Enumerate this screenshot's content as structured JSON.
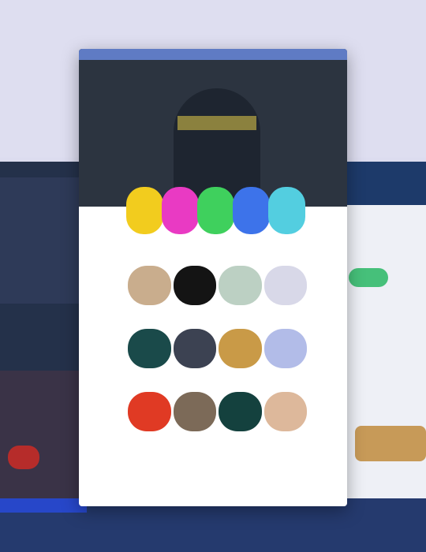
{
  "colors": {
    "background": "#dcdcef",
    "window_bg": "#ffffff",
    "accent_blue": "#2747c9"
  },
  "picker": {
    "section_label": "",
    "swatches": [
      {
        "name": "yellow",
        "color": "#f2cc1e"
      },
      {
        "name": "magenta",
        "color": "#e93ac3"
      },
      {
        "name": "green",
        "color": "#3fd05d"
      },
      {
        "name": "blue",
        "color": "#3d73ea"
      },
      {
        "name": "cyan",
        "color": "#53cee0"
      }
    ],
    "thumbnails": [
      [
        {
          "name": "warm-beige",
          "color": "#c9ad8d"
        },
        {
          "name": "black",
          "color": "#141414"
        },
        {
          "name": "mint-grey",
          "color": "#bcd0c3"
        },
        {
          "name": "pale-lavender",
          "color": "#d8d8e8"
        }
      ],
      [
        {
          "name": "dark-teal",
          "color": "#1a4a4a"
        },
        {
          "name": "charcoal",
          "color": "#3c4252"
        },
        {
          "name": "amber",
          "color": "#c99a47"
        },
        {
          "name": "periwinkle",
          "color": "#b2bce8"
        }
      ],
      [
        {
          "name": "red",
          "color": "#e03a24"
        },
        {
          "name": "sepia",
          "color": "#7c6a58"
        },
        {
          "name": "deep-teal",
          "color": "#14413e"
        },
        {
          "name": "peach",
          "color": "#ddb89b"
        }
      ]
    ]
  },
  "right_panel": {
    "label": ""
  }
}
